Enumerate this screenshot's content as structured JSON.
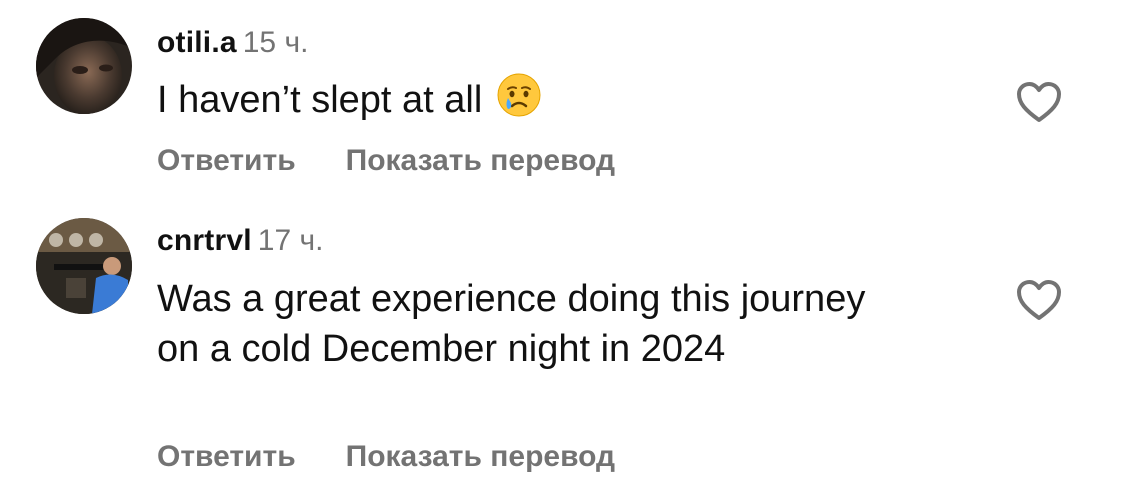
{
  "comments": [
    {
      "username": "otili.a",
      "time": "15 ч.",
      "text": "I haven’t slept at all",
      "emoji": "crying-face",
      "reply_label": "Ответить",
      "translate_label": "Показать перевод"
    },
    {
      "username": "cnrtrvl",
      "time": "17 ч.",
      "text": "Was a great experience doing this journey on a cold December night in 2024",
      "reply_label": "Ответить",
      "translate_label": "Показать перевод"
    }
  ]
}
